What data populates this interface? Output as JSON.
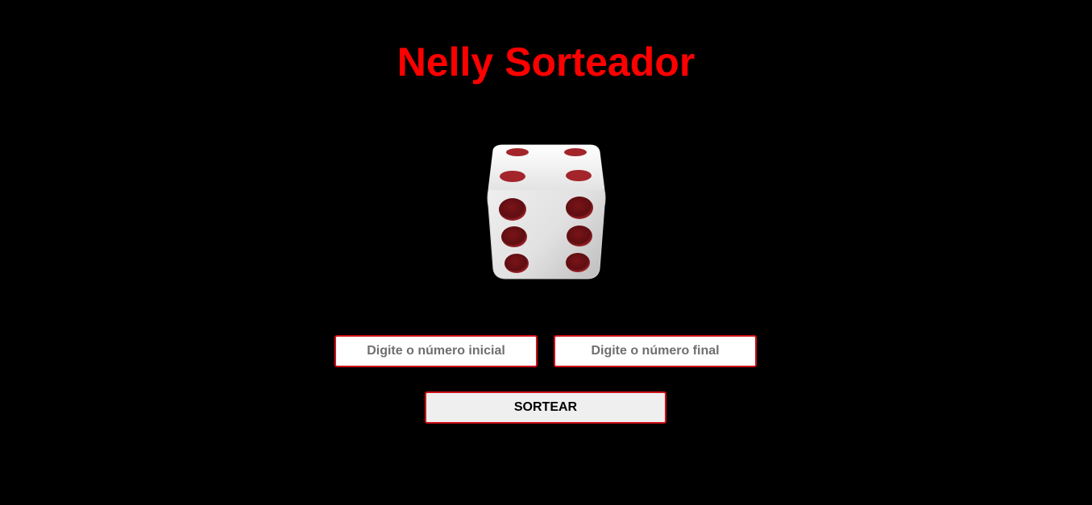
{
  "header": {
    "title": "Nelly Sorteador"
  },
  "dice": {
    "icon": "dice-six-icon",
    "face_color": "#ecebeb",
    "pip_color": "#8b1a1f"
  },
  "form": {
    "start_input": {
      "value": "",
      "placeholder": "Digite o número inicial"
    },
    "end_input": {
      "value": "",
      "placeholder": "Digite o número final"
    },
    "draw_button_label": "SORTEAR"
  },
  "colors": {
    "background": "#000000",
    "accent": "#ff0000",
    "border": "#cc1016"
  }
}
